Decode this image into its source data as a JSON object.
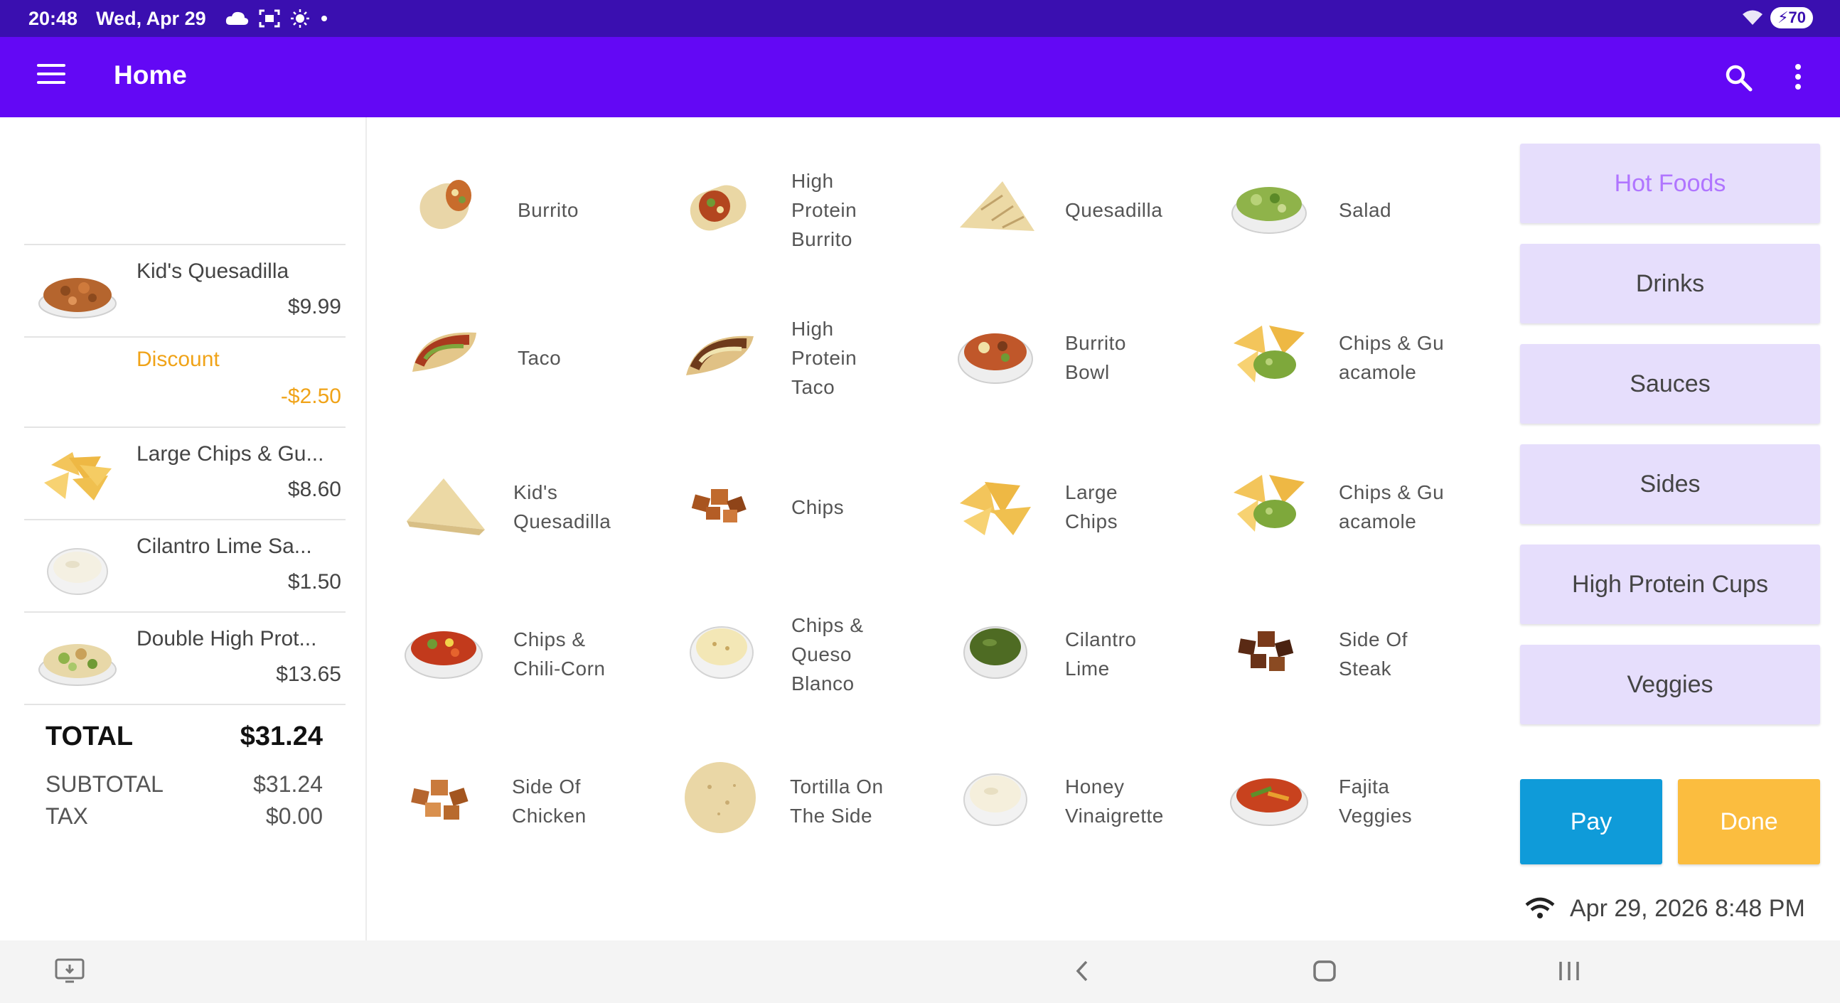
{
  "status_bar": {
    "time": "20:48",
    "date": "Wed, Apr 29",
    "battery": "70"
  },
  "app_bar": {
    "title": "Home"
  },
  "order": {
    "lines": [
      {
        "name": "Kid's Quesadilla",
        "price": "$9.99",
        "icon": "quesadilla-bowl-icon"
      },
      {
        "name": "Discount",
        "price": "-$2.50"
      },
      {
        "name": "Large Chips & Gu...",
        "price": "$8.60",
        "icon": "chips-icon"
      },
      {
        "name": "Cilantro Lime Sa...",
        "price": "$1.50",
        "icon": "sauce-cup-icon"
      },
      {
        "name": "Double High Prot...",
        "price": "$13.65",
        "icon": "protein-bowl-icon"
      }
    ],
    "total_label": "TOTAL",
    "total_value": "$31.24",
    "subtotal_label": "SUBTOTAL",
    "subtotal_value": "$31.24",
    "tax_label": "TAX",
    "tax_value": "$0.00"
  },
  "products": [
    [
      "Burrito",
      "High Protein Burrito",
      "Quesadilla",
      "Salad"
    ],
    [
      "Taco",
      "High Protein Taco",
      "Burrito Bowl",
      "Chips & Guacamole"
    ],
    [
      "Kid's Quesadilla",
      "Chips",
      "Large Chips",
      "Chips & Guacamole"
    ],
    [
      "Chips & Chili-Corn",
      "Chips & Queso Blanco",
      "Cilantro Lime",
      "Side Of Steak"
    ],
    [
      "Side Of Chicken",
      "Tortilla On The Side",
      "Honey Vinaigrette",
      "Fajita Veggies"
    ]
  ],
  "product_labels": {
    "r0c0": "Burrito",
    "r0c1": "High\nProtein\nBurrito",
    "r0c2": "Quesadilla",
    "r0c3": "Salad",
    "r1c0": "Taco",
    "r1c1": "High\nProtein\nTaco",
    "r1c2": "Burrito\nBowl",
    "r1c3": "Chips & Gu\nacamole",
    "r2c0": "Kid's\nQuesadilla",
    "r2c1": "Chips",
    "r2c2": "Large\nChips",
    "r2c3": "Chips & Gu\nacamole",
    "r3c0": "Chips &\nChili-Corn",
    "r3c1": "Chips &\nQueso\nBlanco",
    "r3c2": "Cilantro\nLime",
    "r3c3": "Side Of\nSteak",
    "r4c0": "Side Of\nChicken",
    "r4c1": "Tortilla On\nThe Side",
    "r4c2": "Honey\nVinaigrette",
    "r4c3": "Fajita\nVeggies"
  },
  "categories": [
    "Hot Foods",
    "Drinks",
    "Sauces",
    "Sides",
    "High Protein Cups",
    "Veggies"
  ],
  "active_category": "Hot Foods",
  "actions": {
    "pay": "Pay",
    "done": "Done"
  },
  "clock": "Apr 29, 2026 8:48 PM",
  "colors": {
    "status_bar": "#3a0fb0",
    "app_bar": "#6308f5",
    "category_bg": "#e6defc",
    "active_category_text": "#b075ff",
    "discount": "#f0a318",
    "pay": "#0f9bd9",
    "done": "#fbbd3f"
  }
}
